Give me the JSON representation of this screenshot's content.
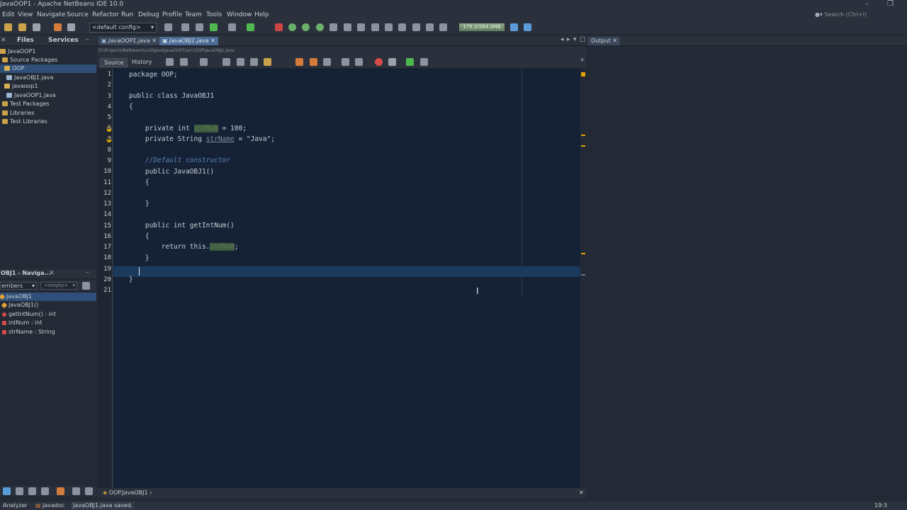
{
  "window": {
    "title": "JavaOOP1 - Apache NetBeans IDE 10.0"
  },
  "menu": [
    "Edit",
    "View",
    "Navigate",
    "Source",
    "Refactor",
    "Run",
    "Debug",
    "Profile",
    "Team",
    "Tools",
    "Window",
    "Help"
  ],
  "search": {
    "placeholder": "Search (Ctrl+I)"
  },
  "toolbar": {
    "config": "<default config>",
    "memory": "175.2/264.0MB"
  },
  "left_panel": {
    "tabs": [
      "Files",
      "Services"
    ],
    "tree": [
      {
        "label": "JavaOOP1",
        "level": 0,
        "selected": false,
        "icon": "project-icon"
      },
      {
        "label": "Source Packages",
        "level": 1,
        "selected": false,
        "icon": "folder-icon"
      },
      {
        "label": "OOP",
        "level": 2,
        "selected": true,
        "icon": "package-icon"
      },
      {
        "label": "JavaOBJ1.java",
        "level": 3,
        "selected": false,
        "icon": "java-file-icon"
      },
      {
        "label": "javaoop1",
        "level": 2,
        "selected": false,
        "icon": "package-icon"
      },
      {
        "label": "JavaOOP1.java",
        "level": 3,
        "selected": false,
        "icon": "java-file-icon"
      },
      {
        "label": "Test Packages",
        "level": 1,
        "selected": false,
        "icon": "folder-icon"
      },
      {
        "label": "Libraries",
        "level": 1,
        "selected": false,
        "icon": "folder-icon"
      },
      {
        "label": "Test Libraries",
        "level": 1,
        "selected": false,
        "icon": "folder-icon"
      }
    ]
  },
  "navigator": {
    "title": "OBJ1 - Naviga...",
    "filter_label": "embers",
    "filter_value": "<empty>",
    "items": [
      {
        "label": "JavaOBJ1",
        "kind": "class",
        "color": "#e0a33a"
      },
      {
        "label": "JavaOBJ1()",
        "kind": "constructor",
        "color": "#e0a33a"
      },
      {
        "label": "getIntNum() : int",
        "kind": "method",
        "color": "#d84b4b"
      },
      {
        "label": "intNum : int",
        "kind": "field",
        "color": "#d84b4b"
      },
      {
        "label": "strName : String",
        "kind": "field",
        "color": "#d84b4b"
      }
    ]
  },
  "editor": {
    "tabs": [
      {
        "label": "JavaOOP1.java",
        "active": false
      },
      {
        "label": "JavaOBJ1.java",
        "active": true
      }
    ],
    "path": "D:\\Projects\\Netbeans\\v10\\Java\\JavaOOP1\\src\\OOP\\JavaOBJ1.java",
    "source_tab": "Source",
    "history_tab": "History",
    "line_numbers": [
      "1",
      "2",
      "3",
      "4",
      "5",
      "6",
      "7",
      "8",
      "9",
      "10",
      "11",
      "12",
      "13",
      "14",
      "15",
      "16",
      "17",
      "18",
      "19",
      "20",
      "21"
    ],
    "code": {
      "l1": "package OOP;",
      "l3": "public class JavaOBJ1",
      "l4": "{",
      "l6a": "    private int ",
      "l6b": "intNum",
      "l6c": " = 100;",
      "l7a": "    private String ",
      "l7b": "strName",
      "l7c": " = \"Java\";",
      "l9": "    //Default constructor",
      "l10": "    public JavaOBJ1()",
      "l11": "    {",
      "l13": "    }",
      "l15": "    public int getIntNum()",
      "l16": "    {",
      "l17a": "        return this.",
      "l17b": "intNum",
      "l17c": ";",
      "l18": "    }",
      "l20": "}"
    },
    "breadcrumb": "OOP.JavaOBJ1"
  },
  "output": {
    "tab": "Output"
  },
  "statusbar": {
    "analyzer": "Analyzer",
    "javadoc": "Javadoc",
    "message": "JavaOBJ1.java saved.",
    "position": "19:3"
  },
  "colors": {
    "accent": "#2f4f78",
    "editor_bg": "#152236",
    "ide_bg": "#232a35"
  }
}
